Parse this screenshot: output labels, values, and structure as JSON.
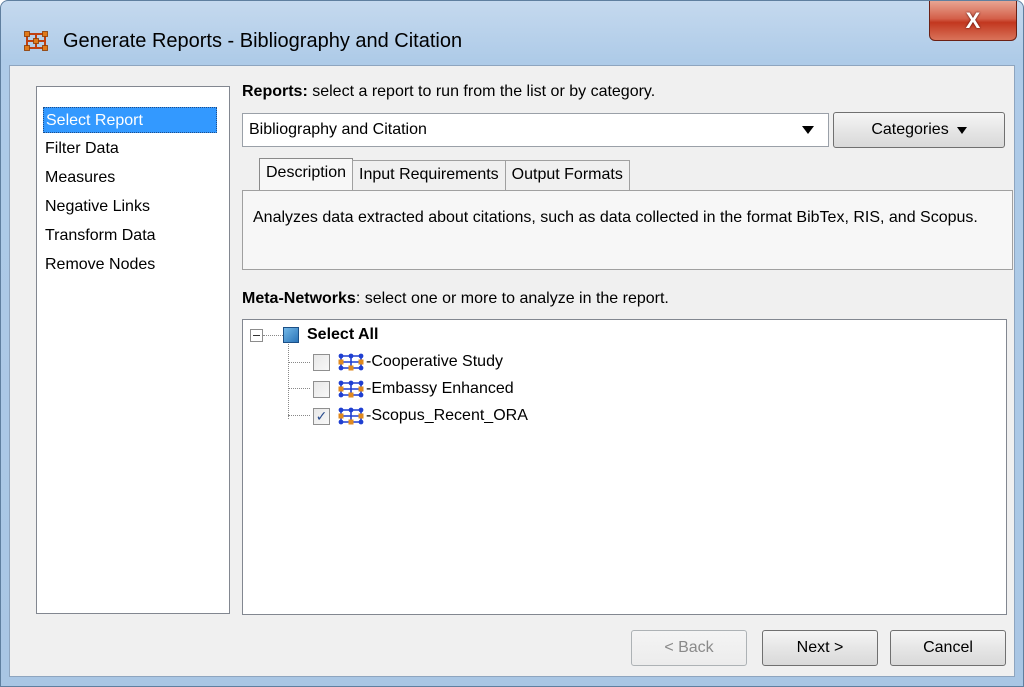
{
  "window": {
    "title": "Generate Reports - Bibliography and Citation",
    "close_label": "X"
  },
  "sidebar": {
    "items": [
      {
        "label": "Select Report",
        "selected": true
      },
      {
        "label": "Filter Data",
        "selected": false
      },
      {
        "label": "Measures",
        "selected": false
      },
      {
        "label": "Negative Links",
        "selected": false
      },
      {
        "label": "Transform Data",
        "selected": false
      },
      {
        "label": "Remove Nodes",
        "selected": false
      }
    ]
  },
  "reports": {
    "label_bold": "Reports:",
    "label_rest": " select a report to run from the list or by category.",
    "selected_value": "Bibliography and Citation",
    "categories_label": "Categories"
  },
  "tabs": [
    {
      "label": "Description",
      "active": true
    },
    {
      "label": "Input Requirements",
      "active": false
    },
    {
      "label": "Output Formats",
      "active": false
    }
  ],
  "description": "Analyzes data extracted about citations, such as data collected in the format BibTex, RIS, and Scopus.",
  "meta_networks": {
    "label_bold": "Meta-Networks",
    "label_rest": ": select one or more to analyze in the report.",
    "select_all_label": "Select All",
    "items": [
      {
        "label": "Cooperative Study",
        "checked": false
      },
      {
        "label": "Embassy Enhanced",
        "checked": false
      },
      {
        "label": "Scopus_Recent_ORA",
        "checked": true
      }
    ]
  },
  "footer": {
    "back_label": "< Back",
    "back_mnemonic": "B",
    "next_label": "Next >",
    "next_mnemonic": "N",
    "cancel_label": "Cancel",
    "cancel_mnemonic": "C"
  },
  "colors": {
    "selection": "#3399ff",
    "close_button": "#c2371f",
    "network_node_blue": "#1f3fd1",
    "network_node_orange": "#e08a1e"
  },
  "icons": {
    "app": "network-grid-icon",
    "network": "meta-network-icon",
    "check": "✓"
  }
}
